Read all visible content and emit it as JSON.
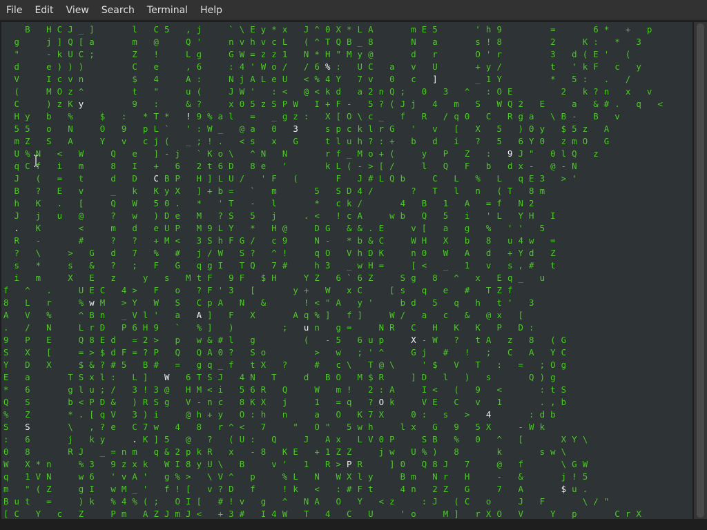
{
  "menu": {
    "items": [
      "File",
      "Edit",
      "View",
      "Search",
      "Terminal",
      "Help"
    ]
  },
  "colors": {
    "menubar_bg": "#323232",
    "menu_text": "#e0e0e0",
    "terminal_bg": "#2e3436",
    "matrix_green": "#4fc72a",
    "highlight_white": "#f2f2f2"
  },
  "icons": {
    "text_cursor": "ibeam-cursor-icon"
  },
  "terminal": {
    "lines": [
      "    B   H C J _ ]       l   C 5   , j     ` \\ E y * x   J ^ 0 X * L A       m E 5       ' h 9         =       6 *   +   p",
      "  g     j ] Q [ a       m   @     Q '     n v h v c L   ( ^ T Q B _ 8       N   a       s ! 8         2     K :   *   3",
      "  \"     - k U C ;       Z   !     L g     G W = z z 1   N * H \" M y @       d   r       O ' r         3   d ( E '   (",
      "  d     e ) ) )         C   e     , 6     : 4 ' W o /   / 6 % :   U C   a   v   U       + y /         t   ' k F   c   y",
      "  V     I c v n         $   4     A :     N j A L e U   < % 4 Y   7 v   0   c   ]       _ 1 Y         *   5 :   .   /",
      "  (     M O z ^         t   \"     u (     J W '   : <   @ < k d   a 2 n Q ;   0   3   ^   : O E         2   k ? n   x   v",
      "  C     ) z K y         9   :     & ?     x 0 5 z S P W   I + F -   5 ? ( J j   4   m   S   W Q 2   E     a   & # .   q   <",
      "  H y   b   %     $   :   * T *   ! 9 % a l   =   _ g z :   X [ O \\ c _   f   R   / q 0   C   R g a   \\ B -   B   v",
      "  5 5   o   N     O   9   p L `   ' : W _   @ a   0   3     s p c k l r G   '   v   [   X   5   ) 0 y   $ 5 z   A",
      "  m Z   S   A     Y   v   c j (   _ ; ! .   < s   x   G     t l u h ? : +   b   d   i   ?   5   6 Y 0   z m O   G",
      "  U % N   <   W     Q   e   ] - j   ` K o \\   ^ N   N       r f _ M o + (     y   P   Z   :   9 J \"   0 l Q   z",
      "  q C f   i   m     8   I   +   6   2 t 6 D   8 e   '       k L ( - > [ /     l   Q   F   b   d x -   @ - N",
      "  J   (   =   t     d   D   C B P   H ] L U /   ' F   (       F   J # L Q b     C   L   %   L   q E 3   > '",
      "  B   ?   E   v     _   k   K y X   ] + b =   `   m       5   S D 4 /       ?   T   l   n   ( T   8 m",
      "  h   K   .   [     Q   W   5 0 .   *   ' T   -   l       *   c k /       4   B   1   A   = f   N 2",
      "  J   j   u   @     ?   w   ) D e   M   ? S   5   j     . <   ! c A     w b   Q   5   i   ' L   Y H   I",
      "  .   K       <     m   d   e U P   M 9 L Y   *   H @     D G   & & . E     v [   a   g   %   ' '   5",
      "  R   -       #     ?   ?   + M <   3 S h F G /   c 9     N -   * b & C     W H   X   b   8   u 4 w   =",
      "  ?   \\     >   G   d   7   %   #   j / W   S ?   ^ !     q O   V h D K     n 0   W   A   d   + Y d   Z",
      "  s   *     s   &   ?   ;   F   G   q g I   T Q   7 #     h 3   _ w H =     [ <   _   1   v   s , #   t",
      "  i   m     X   E   z     y   s   M t F   9 F   $ H     Y Z   6 ` 6 Z     S g   8   ^   x   E q _   u",
      "f   ^   .     U E C   4 >   F   o   ? F ' 3   [       y +   W   x C     [ s   q   e   #   T Z f",
      "8   L   r     % w M   > Y   W   S   C p A   N   &       ! < \" A   y '     b d   5   q   h   t '   3",
      "A   V   %     ^ B n   _ V l '   a   A ]   F   X       A q % ]   f ]     W /   a   c   &   @ x   [",
      ".   /   N     L r D   P 6 H 9   `   % ]   )         ;   u n   g =     N R   C   H   K   K   P   D :",
      "9   P   E     Q 8 E d   = 2 >   p   w & # l   g         (   - 5   6 u p     X - W   ?   t A   z   8   ( G",
      "S   X   [     = > $ d F = ? P   Q   Q A 0 ?   S o         >   w   ; ' ^     G j   #   !   ;   C   A   Y C",
      "Y   D   X     $ & ? # 5   B #   =   g q _ f   t X   ?     #   c \\   T @ \\     ' $   V   T   :   =   ; O g",
      "E   a       T S x l :   L ]   W   6 T S J   4 N   T     d   B O   M $ R     ] D   l   )   s       Q ) g",
      "*   6       g l u ; /   3 ! 3 @   H M < i   5 6 R   Q     W   m !   2 : A     I <   (   9   <       : t S",
      "Q   S       b < P D &   ) R S g   V - n c   8 K X   j     1   = q   ? O k     V E   C   v   1       . , b",
      "%   Z       * . [ q V   3 ) i     @ h + y   O : h   n     a   O   K 7 X     0 :   s   >   4       : d b",
      "S   S       \\   , ? e   C 7 w   4   8   r ^ <   7     \"   O \"   5 w h     l x   G   9   5 X     - W k",
      ":   6       j   k y     . K ] 5   @   ?   ( U :   Q     J   A x   L V 0 P     S B   %   0   ^   [       X Y \\",
      "0   8       R J   _ = n m   q & 2 p k R   x   - 8   K E   + 1 Z Z     j w   U % )   8       k       s w \\",
      "W   X * n     % 3   9 z x k   W I 8 y U \\   B     v '   1   R > P R     ] 0   Q 8 J   7     @   f       \\ G W",
      "q   1 V N     w 6   ' v A '   g % >   \\ V ^   p     % L   N   W X l y     B m   N r   H     -   &       j ! 5",
      "m   \" ( Z     g I   w M _ '   f ! [   v ? D   f     ! k   <   : # F t     4 n   2 Z   G     7   A       $ u .",
      "B u t   =     ) k   % 4 % ( ;   O I [   # ! v   g   ^   N A   O   Y   < z     : J   ( C   o     J   F       \\ / \"",
      "[ C   Y   c   Z     P m   A Z J m J <   + 3 #   I 4 W   T   4   C   U     ' o     M ]   r X O   V     Y   p       C r X"
    ]
  }
}
